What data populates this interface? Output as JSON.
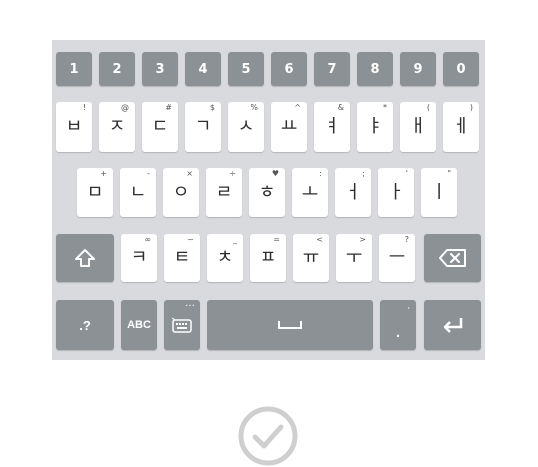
{
  "keyboard": {
    "numbers": [
      "1",
      "2",
      "3",
      "4",
      "5",
      "6",
      "7",
      "8",
      "9",
      "0"
    ],
    "row1": [
      {
        "main": "ㅂ",
        "sub": "!"
      },
      {
        "main": "ㅈ",
        "sub": "@"
      },
      {
        "main": "ㄷ",
        "sub": "#"
      },
      {
        "main": "ㄱ",
        "sub": "$"
      },
      {
        "main": "ㅅ",
        "sub": "%"
      },
      {
        "main": "ㅛ",
        "sub": "^"
      },
      {
        "main": "ㅕ",
        "sub": "&"
      },
      {
        "main": "ㅑ",
        "sub": "*"
      },
      {
        "main": "ㅐ",
        "sub": "("
      },
      {
        "main": "ㅔ",
        "sub": ")"
      }
    ],
    "row2": [
      {
        "main": "ㅁ",
        "sub": "+"
      },
      {
        "main": "ㄴ",
        "sub": "-"
      },
      {
        "main": "ㅇ",
        "sub": "×"
      },
      {
        "main": "ㄹ",
        "sub": "÷"
      },
      {
        "main": "ㅎ",
        "sub": "♥"
      },
      {
        "main": "ㅗ",
        "sub": ":"
      },
      {
        "main": "ㅓ",
        "sub": ";"
      },
      {
        "main": "ㅏ",
        "sub": "'"
      },
      {
        "main": "ㅣ",
        "sub": "\""
      }
    ],
    "row3": [
      {
        "main": "ㅋ",
        "sub": "∞"
      },
      {
        "main": "ㅌ",
        "sub": "~"
      },
      {
        "main": "ㅊ",
        "sub": "_"
      },
      {
        "main": "ㅍ",
        "sub": "="
      },
      {
        "main": "ㅠ",
        "sub": "<"
      },
      {
        "main": "ㅜ",
        "sub": ">"
      },
      {
        "main": "ㅡ",
        "sub": "?"
      }
    ],
    "sym_label": ".?",
    "abc_label": "ABC",
    "emoji_hint": "…",
    "period_main": ".",
    "period_sub": ","
  },
  "colors": {
    "keyboard_bg": "#d9dadd",
    "key_dark": "#8c9196",
    "key_light": "#ffffff",
    "check": "#cfcfcf"
  },
  "icons": {
    "shift": "shift-icon",
    "backspace": "backspace-icon",
    "keyboard_settings": "keyboard-icon",
    "space": "space-icon",
    "enter": "enter-icon",
    "confirm": "checkmark-circle-icon"
  }
}
